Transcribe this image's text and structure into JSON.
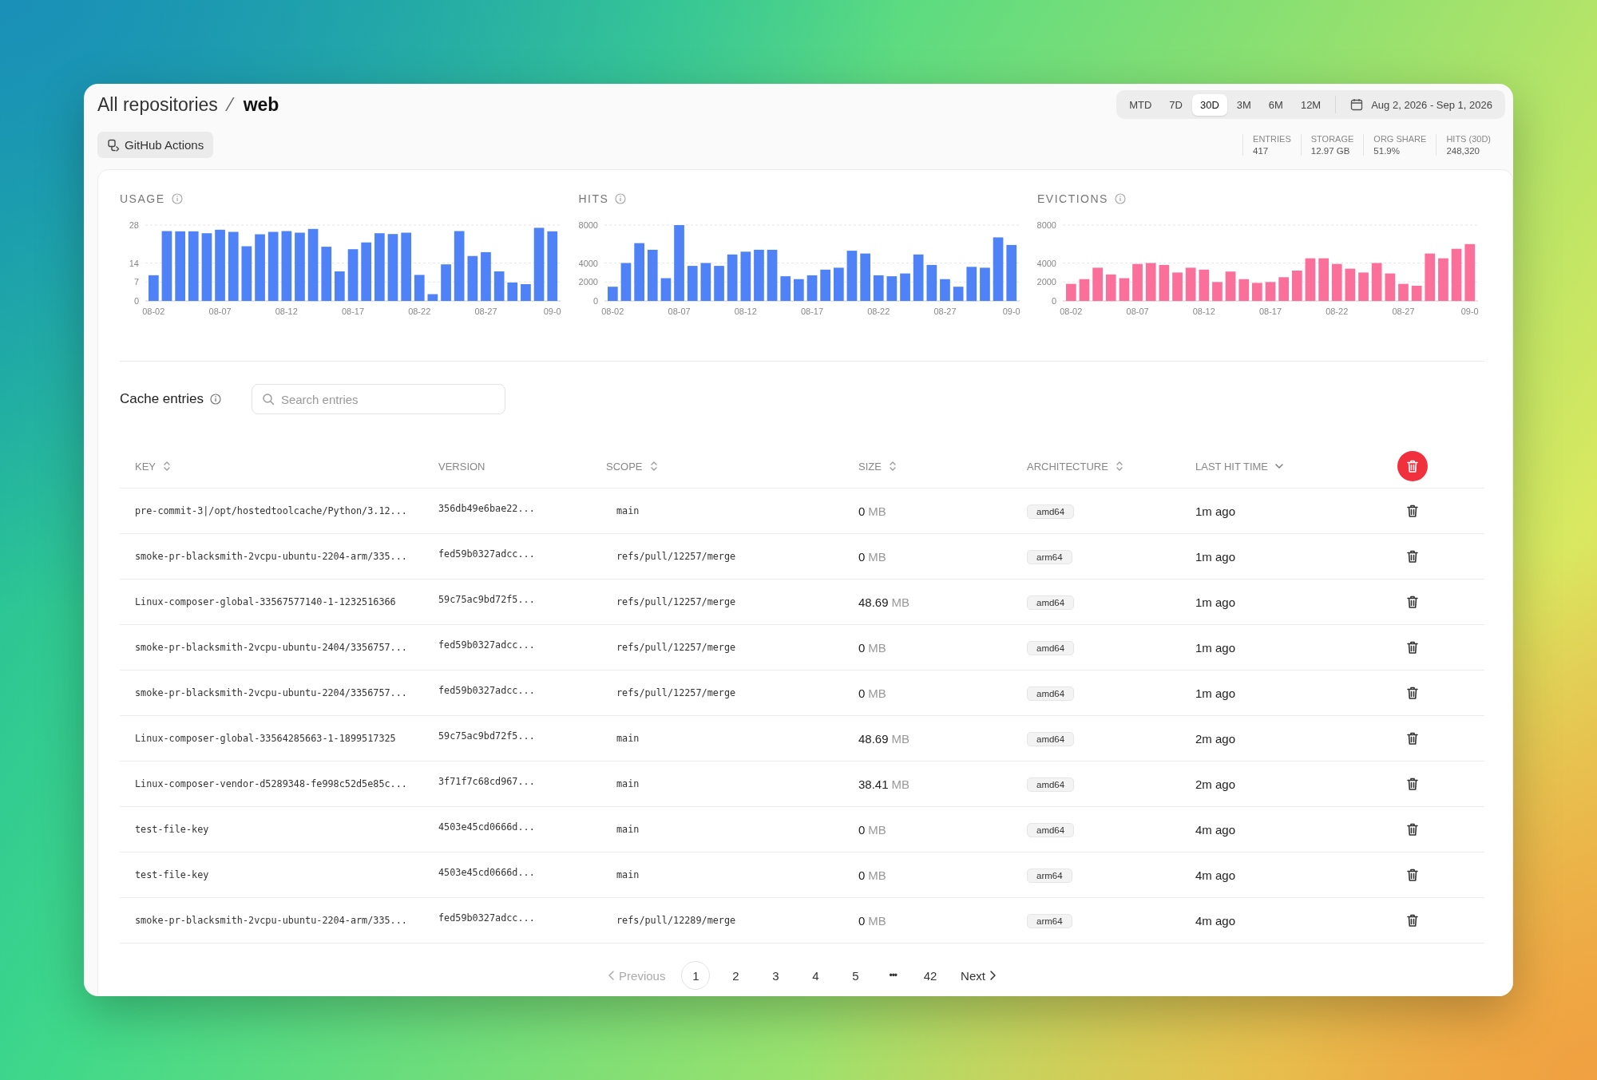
{
  "breadcrumb": {
    "parent": "All repositories",
    "separator": "⁄",
    "current": "web"
  },
  "periods": [
    {
      "label": "MTD",
      "selected": false
    },
    {
      "label": "7D",
      "selected": false
    },
    {
      "label": "30D",
      "selected": true
    },
    {
      "label": "3M",
      "selected": false
    },
    {
      "label": "6M",
      "selected": false
    },
    {
      "label": "12M",
      "selected": false
    }
  ],
  "date_range": "Aug 2, 2026 - Sep 1, 2026",
  "provider_button": "GitHub Actions",
  "stats": [
    {
      "label": "ENTRIES",
      "value": "417"
    },
    {
      "label": "STORAGE",
      "value": "12.97 GB"
    },
    {
      "label": "ORG SHARE",
      "value": "51.9%"
    },
    {
      "label": "HITS (30D)",
      "value": "248,320"
    }
  ],
  "charts": [
    {
      "chart_data": {
        "type": "bar",
        "title": "USAGE",
        "color": "#4f82f7",
        "ylim": [
          0,
          28
        ],
        "yticks": [
          0,
          7,
          14,
          28
        ],
        "categories": [
          "08-02",
          null,
          null,
          null,
          null,
          "08-07",
          null,
          null,
          null,
          null,
          "08-12",
          null,
          null,
          null,
          null,
          "08-17",
          null,
          null,
          null,
          null,
          "08-22",
          null,
          null,
          null,
          null,
          "08-27",
          null,
          null,
          null,
          null,
          "09-0"
        ],
        "values": [
          9.5,
          25.8,
          25.7,
          25.7,
          25,
          26.3,
          25.5,
          20.2,
          24.6,
          25.5,
          25.8,
          25.2,
          26.6,
          20,
          10.9,
          19.1,
          21.6,
          25,
          24.7,
          25.2,
          9.6,
          2.5,
          13.5,
          25.8,
          16.6,
          18,
          10.9,
          6.8,
          6.2,
          27,
          25.7
        ]
      }
    },
    {
      "chart_data": {
        "type": "bar",
        "title": "HITS",
        "color": "#4f82f7",
        "ylim": [
          0,
          8000
        ],
        "yticks": [
          0,
          2000,
          4000,
          8000
        ],
        "categories": [
          "08-02",
          null,
          null,
          null,
          null,
          "08-07",
          null,
          null,
          null,
          null,
          "08-12",
          null,
          null,
          null,
          null,
          "08-17",
          null,
          null,
          null,
          null,
          "08-22",
          null,
          null,
          null,
          null,
          "08-27",
          null,
          null,
          null,
          null,
          "09-0"
        ],
        "values": [
          1500,
          4000,
          6100,
          5400,
          2400,
          8000,
          3700,
          4000,
          3700,
          4900,
          5200,
          5400,
          5400,
          2600,
          2300,
          2700,
          3300,
          3500,
          5300,
          5000,
          2700,
          2600,
          2900,
          4900,
          3800,
          2300,
          1500,
          3600,
          3500,
          6700,
          5900
        ]
      }
    },
    {
      "chart_data": {
        "type": "bar",
        "title": "EVICTIONS",
        "color": "#fb6f9b",
        "ylim": [
          0,
          8000
        ],
        "yticks": [
          0,
          2000,
          4000,
          8000
        ],
        "categories": [
          "08-02",
          null,
          null,
          null,
          null,
          "08-07",
          null,
          null,
          null,
          null,
          "08-12",
          null,
          null,
          null,
          null,
          "08-17",
          null,
          null,
          null,
          null,
          "08-22",
          null,
          null,
          null,
          null,
          "08-27",
          null,
          null,
          null,
          null,
          "09-0"
        ],
        "values": [
          1800,
          2300,
          3500,
          2800,
          2400,
          3900,
          4000,
          3800,
          3000,
          3500,
          3300,
          2000,
          3100,
          2300,
          1900,
          2000,
          2500,
          3200,
          4500,
          4500,
          3900,
          3400,
          3000,
          4000,
          2900,
          1800,
          1600,
          5000,
          4500,
          5500,
          6000
        ]
      }
    }
  ],
  "cache_entries": {
    "title": "Cache entries",
    "search": {
      "placeholder": "Search entries"
    },
    "columns": [
      {
        "label": "KEY",
        "sortable": true,
        "sorted": false
      },
      {
        "label": "VERSION",
        "sortable": false,
        "sorted": false
      },
      {
        "label": "SCOPE",
        "sortable": true,
        "sorted": false
      },
      {
        "label": "SIZE",
        "sortable": true,
        "sorted": false
      },
      {
        "label": "ARCHITECTURE",
        "sortable": true,
        "sorted": false
      },
      {
        "label": "LAST HIT TIME",
        "sortable": true,
        "sorted": true
      }
    ],
    "rows": [
      {
        "key": "pre-commit-3|/opt/hostedtoolcache/Python/3.12...",
        "version": "356db49e6bae22...",
        "scope": "main",
        "size": "0",
        "unit": "MB",
        "architecture": "amd64",
        "last_hit": "1m ago"
      },
      {
        "key": "smoke-pr-blacksmith-2vcpu-ubuntu-2204-arm/335...",
        "version": "fed59b0327adcc...",
        "scope": "refs/pull/12257/merge",
        "size": "0",
        "unit": "MB",
        "architecture": "arm64",
        "last_hit": "1m ago"
      },
      {
        "key": "Linux-composer-global-33567577140-1-1232516366",
        "version": "59c75ac9bd72f5...",
        "scope": "refs/pull/12257/merge",
        "size": "48.69",
        "unit": "MB",
        "architecture": "amd64",
        "last_hit": "1m ago"
      },
      {
        "key": "smoke-pr-blacksmith-2vcpu-ubuntu-2404/3356757...",
        "version": "fed59b0327adcc...",
        "scope": "refs/pull/12257/merge",
        "size": "0",
        "unit": "MB",
        "architecture": "amd64",
        "last_hit": "1m ago"
      },
      {
        "key": "smoke-pr-blacksmith-2vcpu-ubuntu-2204/3356757...",
        "version": "fed59b0327adcc...",
        "scope": "refs/pull/12257/merge",
        "size": "0",
        "unit": "MB",
        "architecture": "amd64",
        "last_hit": "1m ago"
      },
      {
        "key": "Linux-composer-global-33564285663-1-1899517325",
        "version": "59c75ac9bd72f5...",
        "scope": "main",
        "size": "48.69",
        "unit": "MB",
        "architecture": "amd64",
        "last_hit": "2m ago"
      },
      {
        "key": "Linux-composer-vendor-d5289348-fe998c52d5e85c...",
        "version": "3f71f7c68cd967...",
        "scope": "main",
        "size": "38.41",
        "unit": "MB",
        "architecture": "amd64",
        "last_hit": "2m ago"
      },
      {
        "key": "test-file-key",
        "version": "4503e45cd0666d...",
        "scope": "main",
        "size": "0",
        "unit": "MB",
        "architecture": "amd64",
        "last_hit": "4m ago"
      },
      {
        "key": "test-file-key",
        "version": "4503e45cd0666d...",
        "scope": "main",
        "size": "0",
        "unit": "MB",
        "architecture": "arm64",
        "last_hit": "4m ago"
      },
      {
        "key": "smoke-pr-blacksmith-2vcpu-ubuntu-2204-arm/335...",
        "version": "fed59b0327adcc...",
        "scope": "refs/pull/12289/merge",
        "size": "0",
        "unit": "MB",
        "architecture": "arm64",
        "last_hit": "4m ago"
      }
    ]
  },
  "pagination": {
    "previous": {
      "label": "Previous",
      "disabled": true
    },
    "pages": [
      {
        "kind": "page",
        "label": "1",
        "selected": true
      },
      {
        "kind": "page",
        "label": "2",
        "selected": false
      },
      {
        "kind": "page",
        "label": "3",
        "selected": false
      },
      {
        "kind": "page",
        "label": "4",
        "selected": false
      },
      {
        "kind": "page",
        "label": "5",
        "selected": false
      },
      {
        "kind": "ellipsis",
        "label": "•••"
      },
      {
        "kind": "page",
        "label": "42",
        "selected": false
      }
    ],
    "next": {
      "label": "Next",
      "disabled": false
    }
  }
}
